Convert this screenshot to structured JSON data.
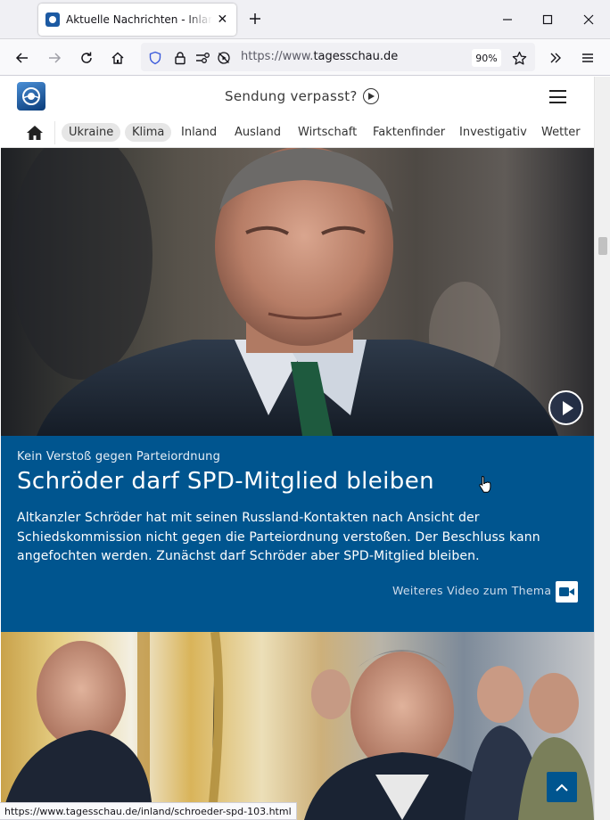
{
  "browser": {
    "tab_title": "Aktuelle Nachrichten - Inland Ausland Wirtschaft",
    "url_prefix": "https://www.",
    "url_domain": "tagesschau.de",
    "zoom": "90%",
    "status_url": "https://www.tagesschau.de/inland/schroeder-spd-103.html"
  },
  "header": {
    "sendung_label": "Sendung verpasst?"
  },
  "nav": {
    "items": [
      "Ukraine",
      "Klima",
      "Inland",
      "Ausland",
      "Wirtschaft",
      "Faktenfinder",
      "Investigativ",
      "Wetter"
    ]
  },
  "teaser": {
    "kicker": "Kein Verstoß gegen Parteiordnung",
    "headline": "Schröder darf SPD-Mitglied bleiben",
    "text": "Altkanzler Schröder hat mit seinen Russland-Kontakten nach Ansicht der Schiedskommission nicht gegen die Parteiordnung verstoßen. Der Beschluss kann angefochten werden. Zunächst darf Schröder aber SPD-Mitglied bleiben.",
    "more_video_label": "Weiteres Video zum Thema"
  },
  "colors": {
    "brand_blue": "#00558f",
    "tab_bar": "#f0f0f4"
  },
  "icons": {
    "home": "home-icon",
    "menu": "hamburger-menu-icon",
    "play": "play-icon",
    "video": "video-camera-icon",
    "back_to_top": "chevron-up-icon"
  }
}
